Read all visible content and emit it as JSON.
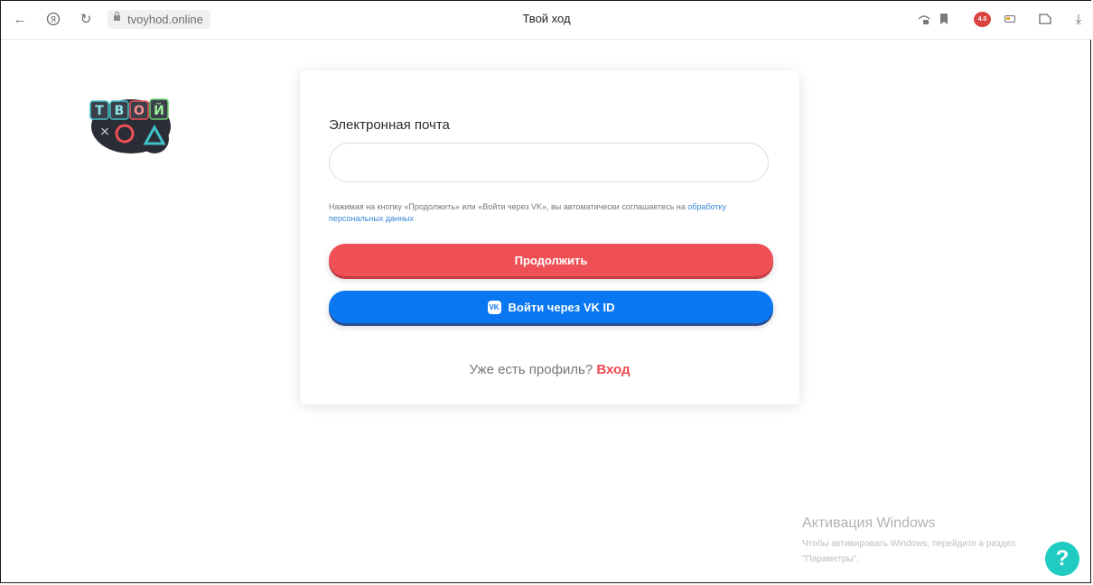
{
  "browser": {
    "url": "tvoyhod.online",
    "tab_title": "Твой ход",
    "extension_badge": "4.0"
  },
  "logo": {
    "line1": [
      "Т",
      "В",
      "О",
      "Й"
    ],
    "line2": [
      "Х",
      "О",
      "Д"
    ]
  },
  "form": {
    "email_label": "Электронная почта",
    "email_value": "",
    "consent_text": "Нажимая на кнопку «Продолжить» или «Войти через VK», вы автоматически соглашаетесь на",
    "consent_link": "обработку персональных данных",
    "continue_label": "Продолжить",
    "vk_label": "Войти через VK ID",
    "vk_icon_text": "VK",
    "have_profile": "Уже есть профиль?",
    "login_label": "Вход"
  },
  "windows": {
    "title": "Активация Windows",
    "subtitle": "Чтобы активировать Windows, перейдите в раздел \"Параметры\"."
  },
  "help": {
    "label": "?"
  },
  "colors": {
    "continue": "#ee5055",
    "vk": "#0a77f2",
    "link": "#3a86d6",
    "help": "#20cbc2"
  },
  "icons": [
    "back-arrow-icon",
    "yandex-icon",
    "reload-icon",
    "lock-icon",
    "incognito-icon",
    "bookmark-icon",
    "battery-icon",
    "reader-icon",
    "download-icon"
  ]
}
